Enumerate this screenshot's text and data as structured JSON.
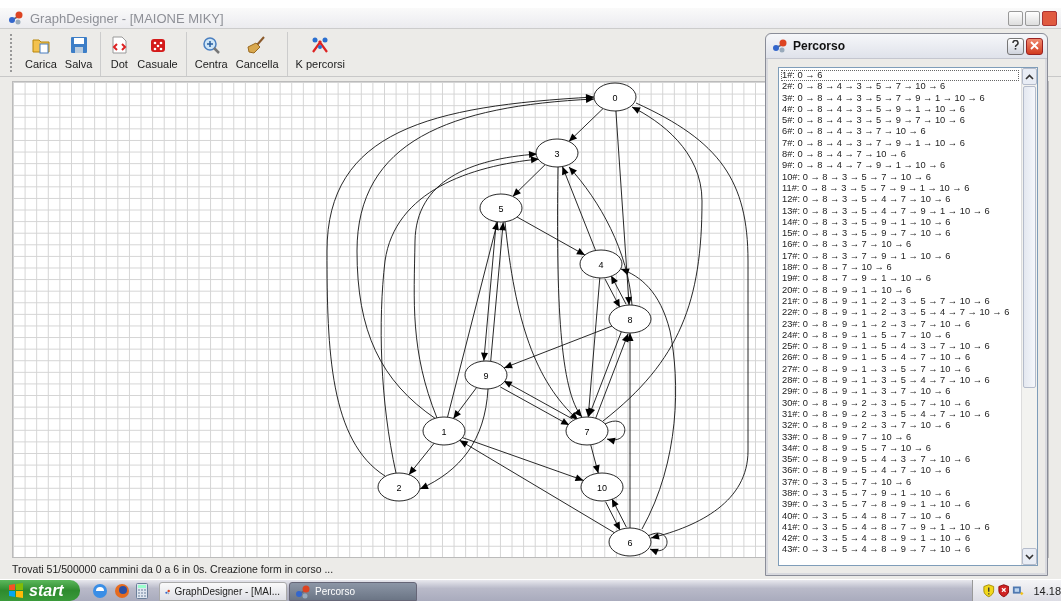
{
  "window": {
    "title": "GraphDesigner - [MAIONE MIKY]"
  },
  "toolbar": {
    "groups": [
      [
        {
          "label": "Carica",
          "kind": "folder"
        },
        {
          "label": "Salva",
          "kind": "floppy"
        }
      ],
      [
        {
          "label": "Dot",
          "kind": "document"
        },
        {
          "label": "Casuale",
          "kind": "dice"
        }
      ],
      [
        {
          "label": "Centra",
          "kind": "zoom"
        },
        {
          "label": "Cancella",
          "kind": "broom"
        }
      ],
      [
        {
          "label": "K percorsi",
          "kind": "tools"
        }
      ]
    ]
  },
  "graph": {
    "nodes": [
      {
        "label": "0"
      },
      {
        "label": "1"
      },
      {
        "label": "2"
      },
      {
        "label": "3"
      },
      {
        "label": "4"
      },
      {
        "label": "5"
      },
      {
        "label": "6"
      },
      {
        "label": "7"
      },
      {
        "label": "8"
      },
      {
        "label": "9"
      },
      {
        "label": "10"
      }
    ]
  },
  "status_bar": "Trovati 51/500000 cammini da 0 a 6 in 0s. Creazione form in corso ...",
  "dialog": {
    "title": "Percorso",
    "paths": [
      {
        "text": "1#: 0 → 6",
        "selected": true
      },
      {
        "text": "2#: 0 → 8 → 4 → 3 → 5 → 7 → 10 → 6",
        "selected": false
      },
      {
        "text": "3#: 0 → 8 → 4 → 3 → 5 → 7 → 9 → 1 → 10 → 6",
        "selected": false
      },
      {
        "text": "4#: 0 → 8 → 4 → 3 → 5 → 9 → 1 → 10 → 6",
        "selected": false
      },
      {
        "text": "5#: 0 → 8 → 4 → 3 → 5 → 9 → 7 → 10 → 6",
        "selected": false
      },
      {
        "text": "6#: 0 → 8 → 4 → 3 → 7 → 10 → 6",
        "selected": false
      },
      {
        "text": "7#: 0 → 8 → 4 → 3 → 7 → 9 → 1 → 10 → 6",
        "selected": false
      },
      {
        "text": "8#: 0 → 8 → 4 → 7 → 10 → 6",
        "selected": false
      },
      {
        "text": "9#: 0 → 8 → 4 → 7 → 9 → 1 → 10 → 6",
        "selected": false
      },
      {
        "text": "10#: 0 → 8 → 3 → 5 → 7 → 10 → 6",
        "selected": false
      },
      {
        "text": "11#: 0 → 8 → 3 → 5 → 7 → 9 → 1 → 10 → 6",
        "selected": false
      },
      {
        "text": "12#: 0 → 8 → 3 → 5 → 4 → 7 → 10 → 6",
        "selected": false
      },
      {
        "text": "13#: 0 → 8 → 3 → 5 → 4 → 7 → 9 → 1 → 10 → 6",
        "selected": false
      },
      {
        "text": "14#: 0 → 8 → 3 → 5 → 9 → 1 → 10 → 6",
        "selected": false
      },
      {
        "text": "15#: 0 → 8 → 3 → 5 → 9 → 7 → 10 → 6",
        "selected": false
      },
      {
        "text": "16#: 0 → 8 → 3 → 7 → 10 → 6",
        "selected": false
      },
      {
        "text": "17#: 0 → 8 → 3 → 7 → 9 → 1 → 10 → 6",
        "selected": false
      },
      {
        "text": "18#: 0 → 8 → 7 → 10 → 6",
        "selected": false
      },
      {
        "text": "19#: 0 → 8 → 7 → 9 → 1 → 10 → 6",
        "selected": false
      },
      {
        "text": "20#: 0 → 8 → 9 → 1 → 10 → 6",
        "selected": false
      },
      {
        "text": "21#: 0 → 8 → 9 → 1 → 2 → 3 → 5 → 7 → 10 → 6",
        "selected": false
      },
      {
        "text": "22#: 0 → 8 → 9 → 1 → 2 → 3 → 5 → 4 → 7 → 10 → 6",
        "selected": false
      },
      {
        "text": "23#: 0 → 8 → 9 → 1 → 2 → 3 → 7 → 10 → 6",
        "selected": false
      },
      {
        "text": "24#: 0 → 8 → 9 → 1 → 5 → 7 → 10 → 6",
        "selected": false
      },
      {
        "text": "25#: 0 → 8 → 9 → 1 → 5 → 4 → 3 → 7 → 10 → 6",
        "selected": false
      },
      {
        "text": "26#: 0 → 8 → 9 → 1 → 5 → 4 → 7 → 10 → 6",
        "selected": false
      },
      {
        "text": "27#: 0 → 8 → 9 → 1 → 3 → 5 → 7 → 10 → 6",
        "selected": false
      },
      {
        "text": "28#: 0 → 8 → 9 → 1 → 3 → 5 → 4 → 7 → 10 → 6",
        "selected": false
      },
      {
        "text": "29#: 0 → 8 → 9 → 1 → 3 → 7 → 10 → 6",
        "selected": false
      },
      {
        "text": "30#: 0 → 8 → 9 → 2 → 3 → 5 → 7 → 10 → 6",
        "selected": false
      },
      {
        "text": "31#: 0 → 8 → 9 → 2 → 3 → 5 → 4 → 7 → 10 → 6",
        "selected": false
      },
      {
        "text": "32#: 0 → 8 → 9 → 2 → 3 → 7 → 10 → 6",
        "selected": false
      },
      {
        "text": "33#: 0 → 8 → 9 → 7 → 10 → 6",
        "selected": false
      },
      {
        "text": "34#: 0 → 8 → 9 → 5 → 7 → 10 → 6",
        "selected": false
      },
      {
        "text": "35#: 0 → 8 → 9 → 5 → 4 → 3 → 7 → 10 → 6",
        "selected": false
      },
      {
        "text": "36#: 0 → 8 → 9 → 5 → 4 → 7 → 10 → 6",
        "selected": false
      },
      {
        "text": "37#: 0 → 3 → 5 → 7 → 10 → 6",
        "selected": false
      },
      {
        "text": "38#: 0 → 3 → 5 → 7 → 9 → 1 → 10 → 6",
        "selected": false
      },
      {
        "text": "39#: 0 → 3 → 5 → 7 → 8 → 9 → 1 → 10 → 6",
        "selected": false
      },
      {
        "text": "40#: 0 → 3 → 5 → 4 → 8 → 7 → 10 → 6",
        "selected": false
      },
      {
        "text": "41#: 0 → 3 → 5 → 4 → 8 → 7 → 9 → 1 → 10 → 6",
        "selected": false
      },
      {
        "text": "42#: 0 → 3 → 5 → 4 → 8 → 9 → 1 → 10 → 6",
        "selected": false
      },
      {
        "text": "43#: 0 → 3 → 5 → 4 → 8 → 9 → 7 → 10 → 6",
        "selected": false
      }
    ]
  },
  "taskbar": {
    "start": "start",
    "tasks": [
      {
        "label": "GraphDesigner - [MAI...",
        "active": false
      },
      {
        "label": "Percorso",
        "active": true
      }
    ],
    "clock": "14.18"
  }
}
